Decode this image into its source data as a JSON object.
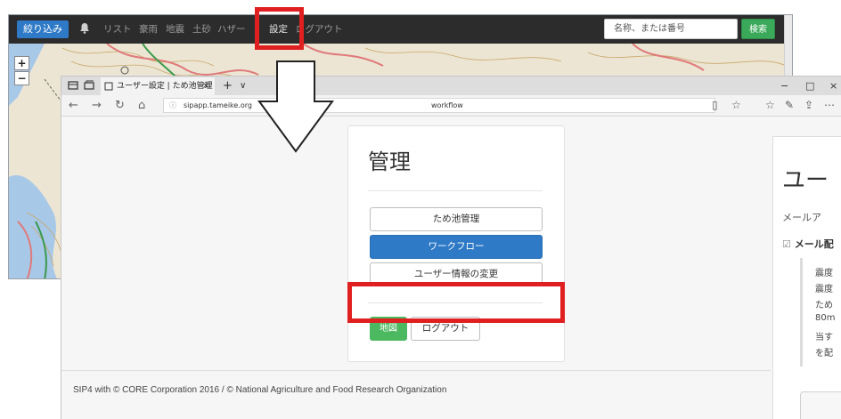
{
  "bg_app": {
    "filter_button": "絞り込み",
    "bell_icon": "bell-icon",
    "nav_items": [
      "リスト",
      "豪雨",
      "地震",
      "土砂",
      "ハザー"
    ],
    "nav_settings": "設定",
    "nav_logout": "ログアウト",
    "search_placeholder": "名称、または番号",
    "search_button": "検索",
    "zoom_in": "+",
    "zoom_out": "−"
  },
  "browser": {
    "tab_title": "ユーザー設定 | ため池管理",
    "tab_close": "×",
    "tab_new": "+",
    "tab_list": "∨",
    "window_controls": [
      "−",
      "□",
      "×"
    ],
    "url_host": "sipapp.tameike.org",
    "url_path": "workflow",
    "nav_icons": [
      "back-icon",
      "forward-icon",
      "refresh-icon",
      "home-icon"
    ]
  },
  "panel": {
    "title": "管理",
    "buttons": {
      "pond_management": "ため池管理",
      "workflow": "ワークフロー",
      "user_info": "ユーザー情報の変更"
    },
    "map_button": "地図",
    "logout_button": "ログアウト"
  },
  "footer": {
    "text": "SIP4 with © CORE Corporation 2016 / © National Agriculture and Food Research Organization"
  },
  "right_panel": {
    "title": "ユー",
    "subtitle": "メールア",
    "checkbox_label": "メール配",
    "lines": [
      "震度",
      "震度",
      "ため",
      "80m",
      "当す",
      "を配"
    ]
  },
  "colors": {
    "highlight": "#e02020",
    "primary": "#2f7ac6",
    "success": "#4cb860"
  }
}
